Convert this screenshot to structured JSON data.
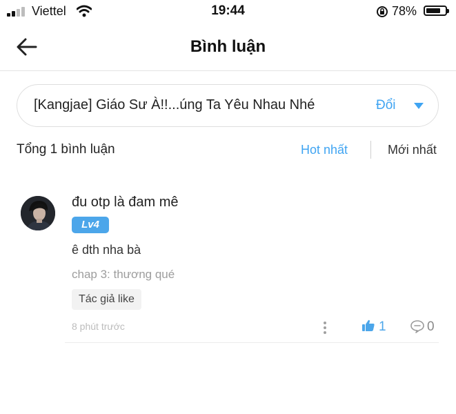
{
  "status_bar": {
    "carrier": "Viettel",
    "time": "19:44",
    "battery_percent": "78%",
    "battery_level": 0.78,
    "icons": [
      "signal-icon",
      "wifi-icon",
      "rotation-lock-icon",
      "battery-icon"
    ]
  },
  "nav": {
    "title": "Bình luận",
    "back_icon": "arrow-left-icon"
  },
  "story_selector": {
    "title": "[Kangjae] Giáo Sư À!!...úng Ta Yêu Nhau Nhé",
    "change_label": "Đổi",
    "caret_icon": "caret-down-icon"
  },
  "comments_header": {
    "total": "Tổng 1 bình luận",
    "sort_hot": "Hot nhất",
    "sort_new": "Mới nhất",
    "active_sort": "Hot nhất"
  },
  "comments": [
    {
      "username": "đu otp là đam mê",
      "level": "Lv4",
      "content": "ê dth nha bà",
      "chapter": "chap 3: thương qué",
      "author_like_label": "Tác giả like",
      "time": "8 phút trước",
      "likes": "1",
      "replies": "0"
    }
  ],
  "colors": {
    "accent": "#3fa4f2",
    "level_badge": "#4ca6ea",
    "muted_text": "#9d9d9d"
  }
}
